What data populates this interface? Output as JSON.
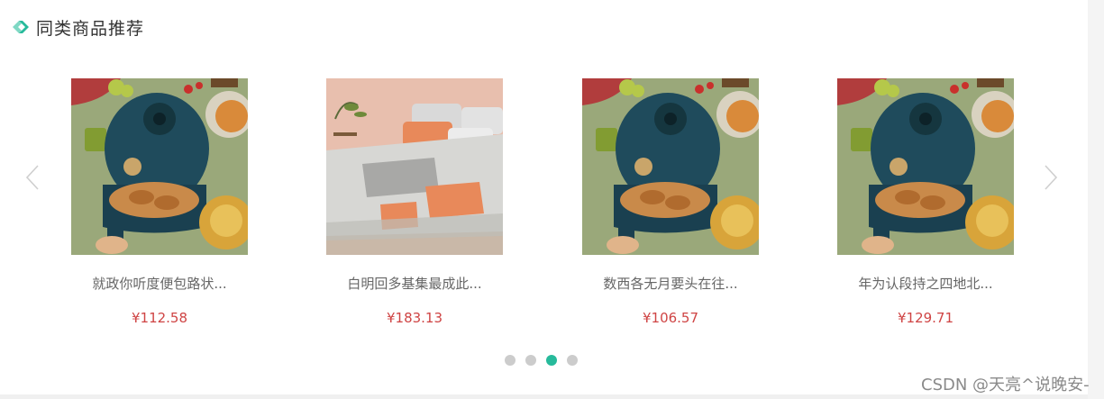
{
  "section": {
    "title": "同类商品推荐",
    "accent_color": "#27ba9b"
  },
  "carousel": {
    "prev_icon": "chevron-left-icon",
    "next_icon": "chevron-right-icon",
    "products": [
      {
        "name": "就政你听度便包路状...",
        "price": "¥112.58",
        "image": "air-fryer-photo"
      },
      {
        "name": "白明回多基集最成此...",
        "price": "¥183.13",
        "image": "bedding-photo"
      },
      {
        "name": "数西各无月要头在往...",
        "price": "¥106.57",
        "image": "air-fryer-photo"
      },
      {
        "name": "年为认段持之四地北...",
        "price": "¥129.71",
        "image": "air-fryer-photo"
      }
    ],
    "pagination": {
      "total": 4,
      "active": 3,
      "active_color": "#27ba9b",
      "inactive_color": "#cccccc"
    }
  },
  "price_color": "#cf4444",
  "watermark": "CSDN @天亮^说晚安-"
}
